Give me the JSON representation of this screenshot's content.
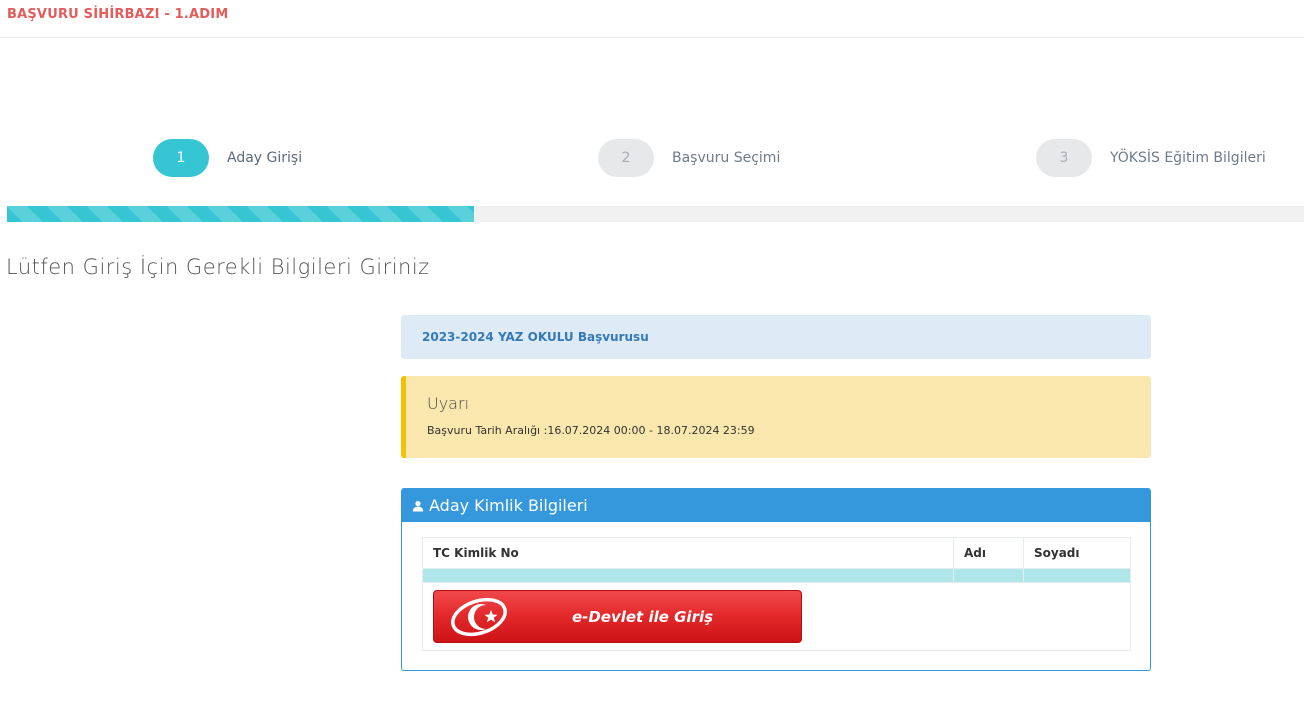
{
  "header": {
    "title": "BAŞVURU SİHİRBAZI - 1.ADIM"
  },
  "steps": [
    {
      "number": "1",
      "label": "Aday Girişi",
      "state": "active"
    },
    {
      "number": "2",
      "label": "Başvuru Seçimi",
      "state": "inactive"
    },
    {
      "number": "3",
      "label": "YÖKSİS Eğitim Bilgileri",
      "state": "inactive"
    }
  ],
  "progress": {
    "percent": 36,
    "color": "#36c6d3"
  },
  "page_heading": "Lütfen Giriş İçin Gerekli Bilgileri Giriniz",
  "info_box": {
    "text": "2023-2024 YAZ OKULU Başvurusu"
  },
  "warning_box": {
    "title": "Uyarı",
    "text": "Başvuru Tarih Aralığı :16.07.2024 00:00 - 18.07.2024 23:59"
  },
  "identity_panel": {
    "title": "Aday Kimlik Bilgileri",
    "icon": "user-icon",
    "columns": [
      "TC Kimlik No",
      "Adı",
      "Soyadı"
    ],
    "login_button_label": "e-Devlet ile Giriş"
  },
  "colors": {
    "accent_red": "#e35b5a",
    "primary_blue": "#3598dc",
    "step_active": "#36c6d3",
    "warning_bg": "#f9e7ad",
    "info_bg": "#dfeaf7"
  }
}
